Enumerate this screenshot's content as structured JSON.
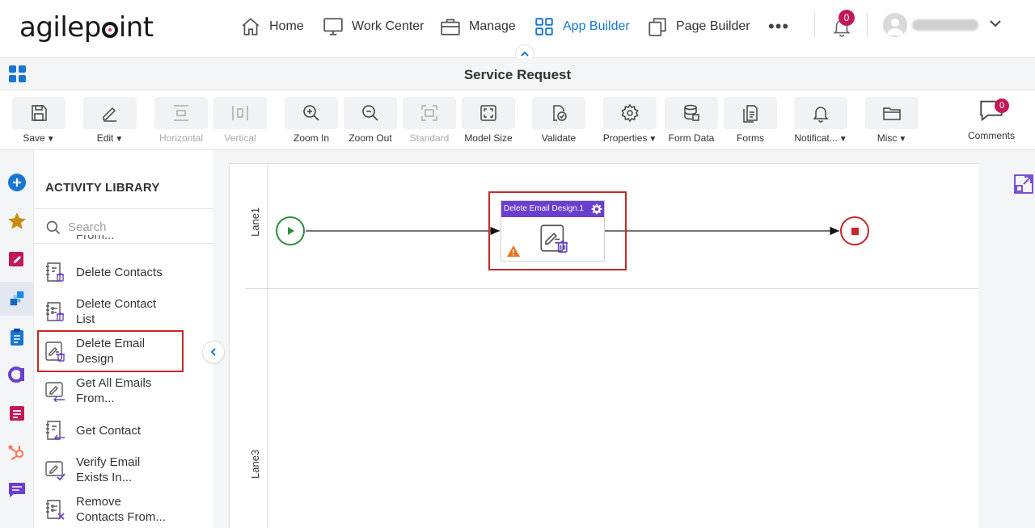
{
  "brand": {
    "logo_text_a": "agilep",
    "logo_text_b": "int"
  },
  "nav": {
    "items": [
      {
        "label": "Home",
        "icon": "home-icon"
      },
      {
        "label": "Work Center",
        "icon": "monitor-icon"
      },
      {
        "label": "Manage",
        "icon": "briefcase-icon"
      },
      {
        "label": "App Builder",
        "icon": "app-builder-icon"
      },
      {
        "label": "Page Builder",
        "icon": "page-builder-icon"
      }
    ],
    "more": "•••",
    "notifications_count": "0"
  },
  "titlebar": {
    "title": "Service Request"
  },
  "toolbar": {
    "save": "Save",
    "edit": "Edit",
    "horizontal": "Horizontal",
    "vertical": "Vertical",
    "zoom_in": "Zoom In",
    "zoom_out": "Zoom Out",
    "standard": "Standard",
    "model_size": "Model Size",
    "validate": "Validate",
    "properties": "Properties",
    "form_data": "Form Data",
    "forms": "Forms",
    "notifications": "Notificat...",
    "misc": "Misc",
    "comments": "Comments",
    "comments_count": "0"
  },
  "library": {
    "title": "ACTIVITY LIBRARY",
    "search_placeholder": "Search",
    "clipped_text": "From...",
    "items": [
      {
        "line1": "Delete Contacts",
        "line2": ""
      },
      {
        "line1": "Delete Contact",
        "line2": "List"
      },
      {
        "line1": "Delete Email",
        "line2": "Design"
      },
      {
        "line1": "Get All Emails",
        "line2": "From..."
      },
      {
        "line1": "Get Contact",
        "line2": ""
      },
      {
        "line1": "Verify Email",
        "line2": "Exists In..."
      },
      {
        "line1": "Remove",
        "line2": "Contacts From..."
      }
    ]
  },
  "canvas": {
    "lanes": [
      "Lane1",
      "Lane3"
    ],
    "activity": {
      "title": "Delete Email Design.1"
    }
  },
  "colors": {
    "accent": "#1976d2",
    "activity_header": "#6a3fd0",
    "highlight": "#c62828",
    "badge": "#c2185b",
    "start": "#2e8b3a"
  }
}
